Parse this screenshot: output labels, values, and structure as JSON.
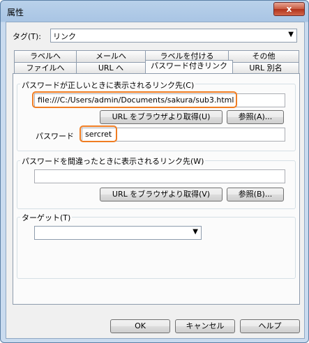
{
  "window": {
    "title": "属性",
    "close_label": "x"
  },
  "tag": {
    "label": "タグ(T):",
    "value": "リンク"
  },
  "tabs_row1": [
    "ラベルへ",
    "メールへ",
    "ラベルを付ける",
    "その他"
  ],
  "tabs_row2": [
    "ファイルへ",
    "URL へ",
    "パスワード付きリンク",
    "URL 別名"
  ],
  "correct": {
    "title": "パスワードが正しいときに表示されるリンク先(C)",
    "value": "file:///C:/Users/admin/Documents/sakura/sub3.html",
    "browser_btn": "URL をブラウザより取得(U)",
    "browse_btn": "参照(A)..."
  },
  "password": {
    "label": "パスワード",
    "value": "sercret"
  },
  "wrong": {
    "title": "パスワードを間違ったときに表示されるリンク先(W)",
    "value": "",
    "browser_btn": "URL をブラウザより取得(V)",
    "browse_btn": "参照(B)..."
  },
  "target": {
    "title": "ターゲット(T)",
    "value": ""
  },
  "footer": {
    "ok": "OK",
    "cancel": "キャンセル",
    "help": "ヘルプ"
  },
  "colors": {
    "highlight": "#f07d22",
    "frame": "#b9d1ea"
  }
}
